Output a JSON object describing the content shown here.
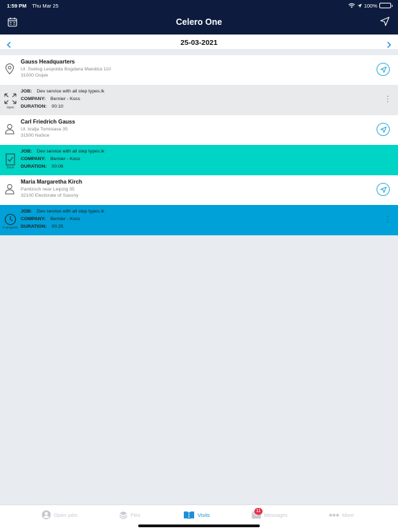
{
  "status": {
    "time": "1:59 PM",
    "date": "Thu Mar 25",
    "battery": "100%",
    "battery_level": 1.0
  },
  "header": {
    "title": "Celero One",
    "left_icon": "calendar-icon",
    "right_icon": "location-arrow-icon"
  },
  "date_nav": {
    "date": "25-03-2021"
  },
  "labels": {
    "job": "JOB:",
    "company": "COMPANY:",
    "duration": "DURATION:"
  },
  "visits": [
    {
      "place": {
        "name": "Gauss Headquarters",
        "address1": "Ul. Svetog Leopolda Bogdana Mandića 110",
        "address2": "31000 Osijek",
        "icon": "map-pin-icon"
      },
      "job": {
        "status": "Open",
        "status_icon": "expand-icon",
        "name": "Dev service with all step types.lk",
        "company": "Bernier - Koss",
        "duration": "00:10",
        "color": "#e8eaeb"
      }
    },
    {
      "place": {
        "name": "Carl Friedrich Gauss",
        "address1": "Ul. kralja Tomislava 35",
        "address2": "31500 Našice",
        "icon": "person-icon"
      },
      "job": {
        "status": "Done",
        "status_icon": "checked-document-icon",
        "name": "Dev service with all step types.lk",
        "company": "Bernier - Koss",
        "duration": "00:06",
        "color": "#00d4c5"
      }
    },
    {
      "place": {
        "name": "Maria Margaretha Kirch",
        "address1": "Panitzsch near Leipzig 35",
        "address2": "32100  Electorate of Saxony",
        "icon": "person-icon"
      },
      "job": {
        "status": "In progress",
        "status_icon": "clock-icon",
        "name": "Dev service with all step types.lk",
        "company": "Bernier - Koss",
        "duration": "00:25",
        "color": "#00a1d8"
      }
    }
  ],
  "tabs": [
    {
      "label": "Open jobs",
      "icon": "person-circle-icon",
      "active": false
    },
    {
      "label": "Flex",
      "icon": "layers-icon",
      "active": false
    },
    {
      "label": "Visits",
      "icon": "book-icon",
      "active": true
    },
    {
      "label": "Messages",
      "icon": "envelope-icon",
      "badge": "11",
      "active": false
    },
    {
      "label": "More",
      "icon": "dots-icon",
      "active": false
    }
  ],
  "colors": {
    "header_bg": "#0d1b3e",
    "accent": "#1f8fd6",
    "nav_button": "#2aa9d6",
    "badge": "#e8334a"
  }
}
